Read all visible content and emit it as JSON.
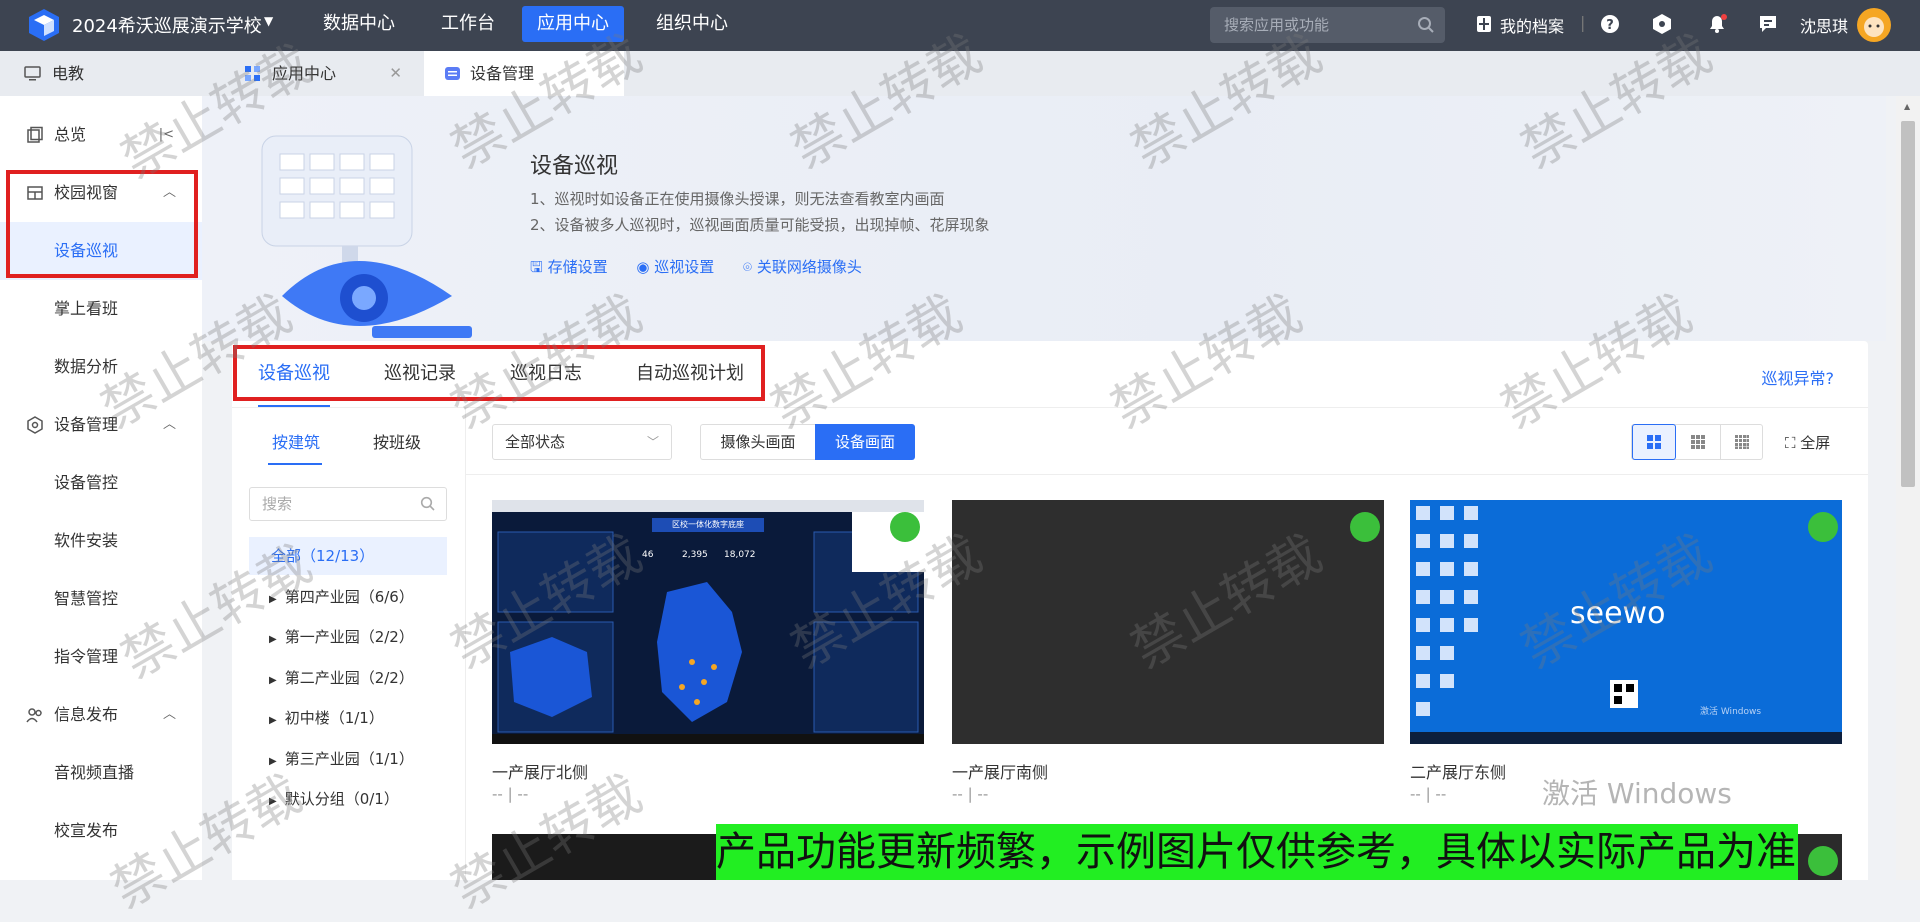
{
  "topbar": {
    "school": "2024希沃巡展演示学校",
    "nav": [
      "数据中心",
      "工作台",
      "应用中心",
      "组织中心"
    ],
    "active_nav": "应用中心",
    "search_placeholder": "搜索应用或功能",
    "archive": "我的档案",
    "user": "沈思琪"
  },
  "page_tabs": [
    {
      "label": "电教"
    },
    {
      "label": "应用中心"
    },
    {
      "label": "设备管理"
    }
  ],
  "sidebar": {
    "items": [
      {
        "label": "总览"
      },
      {
        "label": "校园视窗"
      },
      {
        "label": "设备巡视"
      },
      {
        "label": "掌上看班"
      },
      {
        "label": "数据分析"
      },
      {
        "label": "设备管理"
      },
      {
        "label": "设备管控"
      },
      {
        "label": "软件安装"
      },
      {
        "label": "智慧管控"
      },
      {
        "label": "指令管理"
      },
      {
        "label": "信息发布"
      },
      {
        "label": "音视频直播"
      },
      {
        "label": "校宣发布"
      }
    ]
  },
  "banner": {
    "title": "设备巡视",
    "note1": "1、巡视时如设备正在使用摄像头授课，则无法查看教室内画面",
    "note2": "2、设备被多人巡视时，巡视画面质量可能受损，出现掉帧、花屏现象",
    "links": [
      "存储设置",
      "巡视设置",
      "关联网络摄像头"
    ]
  },
  "tabs": [
    "设备巡视",
    "巡视记录",
    "巡视日志",
    "自动巡视计划"
  ],
  "help_link": "巡视异常?",
  "filter": {
    "group_tabs": [
      "按建筑",
      "按班级"
    ],
    "search_placeholder": "搜索",
    "status": "全部状态",
    "view_toggle": [
      "摄像头画面",
      "设备画面"
    ],
    "fullscreen": "全屏"
  },
  "tree": [
    "全部（12/13）",
    "第四产业园（6/6）",
    "第一产业园（2/2）",
    "第二产业园（2/2）",
    "初中楼（1/1）",
    "第三产业园（1/1）",
    "默认分组（0/1）"
  ],
  "cards": [
    {
      "title": "一产展厅北侧",
      "sub": "-- | --",
      "screen_title": "区校一体化数字底座",
      "stats": [
        "46",
        "2,395",
        "18,072"
      ]
    },
    {
      "title": "一产展厅南侧",
      "sub": "-- | --"
    },
    {
      "title": "二产展厅东侧",
      "sub": "-- | --",
      "brand": "seewo",
      "activation": "激活 Windows"
    }
  ],
  "watermark": "禁止转载",
  "notice": "产品功能更新频繁，示例图片仅供参考，具体以实际产品为准",
  "colors": {
    "primary": "#2a6ef5",
    "topbar": "#3d4451",
    "highlight": "#e02020",
    "notice": "#22ee22"
  }
}
